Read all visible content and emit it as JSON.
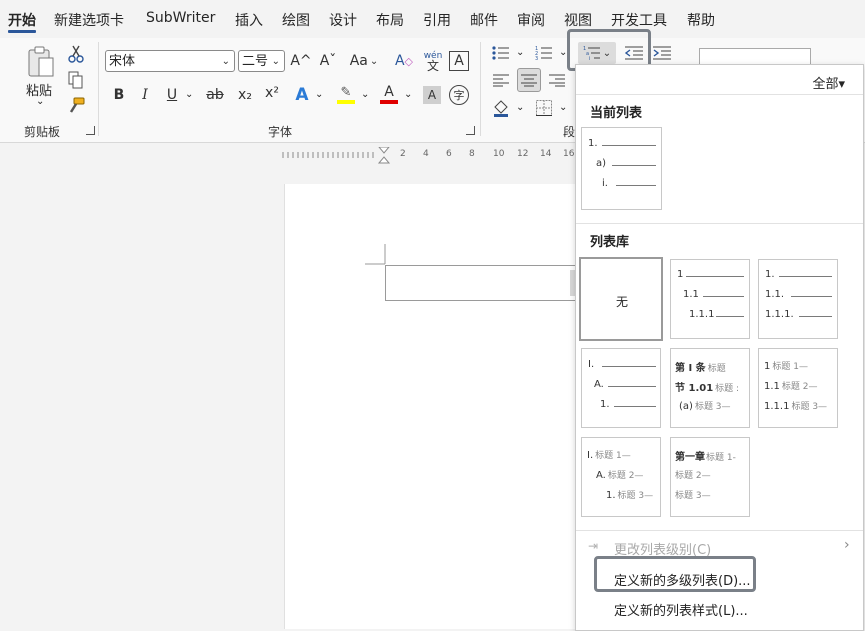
{
  "tabs": [
    "开始",
    "新建选项卡",
    "SubWriter",
    "插入",
    "绘图",
    "设计",
    "布局",
    "引用",
    "邮件",
    "审阅",
    "视图",
    "开发工具",
    "帮助"
  ],
  "clipboard": {
    "paste_label": "粘贴",
    "group_label": "剪贴板"
  },
  "font": {
    "name": "宋体",
    "size": "二号",
    "group_label": "字体",
    "pinyin_top": "wén",
    "pinyin_bottom": "文",
    "change_case": "Aa",
    "bold": "B",
    "italic": "I",
    "underline": "U",
    "strike": "ab",
    "subscript": "x₂",
    "superscript": "x²",
    "grow": "A^",
    "shrink": "Aˇ"
  },
  "paragraph": {
    "group_label": "段"
  },
  "dropdown": {
    "filter_label": "全部▾",
    "current_list_heading": "当前列表",
    "library_heading": "列表库",
    "current_list": [
      "1.",
      "a)",
      "i."
    ],
    "library": [
      {
        "kind": "none",
        "text": "无"
      },
      {
        "kind": "lines",
        "rows": [
          "1",
          "1.1",
          "1.1.1"
        ]
      },
      {
        "kind": "lines",
        "rows": [
          "1.",
          "1.1.",
          "1.1.1."
        ]
      },
      {
        "kind": "lines",
        "rows": [
          "I.",
          "A.",
          "1."
        ]
      },
      {
        "kind": "headed",
        "rows": [
          [
            "第 Ⅰ 条",
            "标题"
          ],
          [
            "节 1.01",
            "标题 :"
          ],
          [
            "(a)",
            "标题 3—"
          ]
        ]
      },
      {
        "kind": "headed",
        "rows": [
          [
            "1",
            "标题 1—"
          ],
          [
            "1.1",
            "标题 2—"
          ],
          [
            "1.1.1",
            "标题 3—"
          ]
        ]
      },
      {
        "kind": "headed",
        "rows": [
          [
            "I.",
            "标题 1—"
          ],
          [
            "A.",
            "标题 2—"
          ],
          [
            "1.",
            "标题 3—"
          ]
        ]
      },
      {
        "kind": "headed",
        "rows": [
          [
            "第一章",
            "标题 1-"
          ],
          [
            "",
            "标题 2—"
          ],
          [
            "",
            "标题 3—"
          ]
        ]
      }
    ],
    "change_level": "更改列表级别(C)",
    "define_multilevel": "定义新的多级列表(D)...",
    "define_style": "定义新的列表样式(L)..."
  },
  "ruler": {
    "ticks": [
      "2",
      "4",
      "6",
      "8",
      "10",
      "12",
      "14",
      "16"
    ]
  },
  "colors": {
    "accent": "#2b579a",
    "highlight_border": "#7a8088",
    "highlighter": "#ffff00",
    "font_color": "#e00000"
  }
}
